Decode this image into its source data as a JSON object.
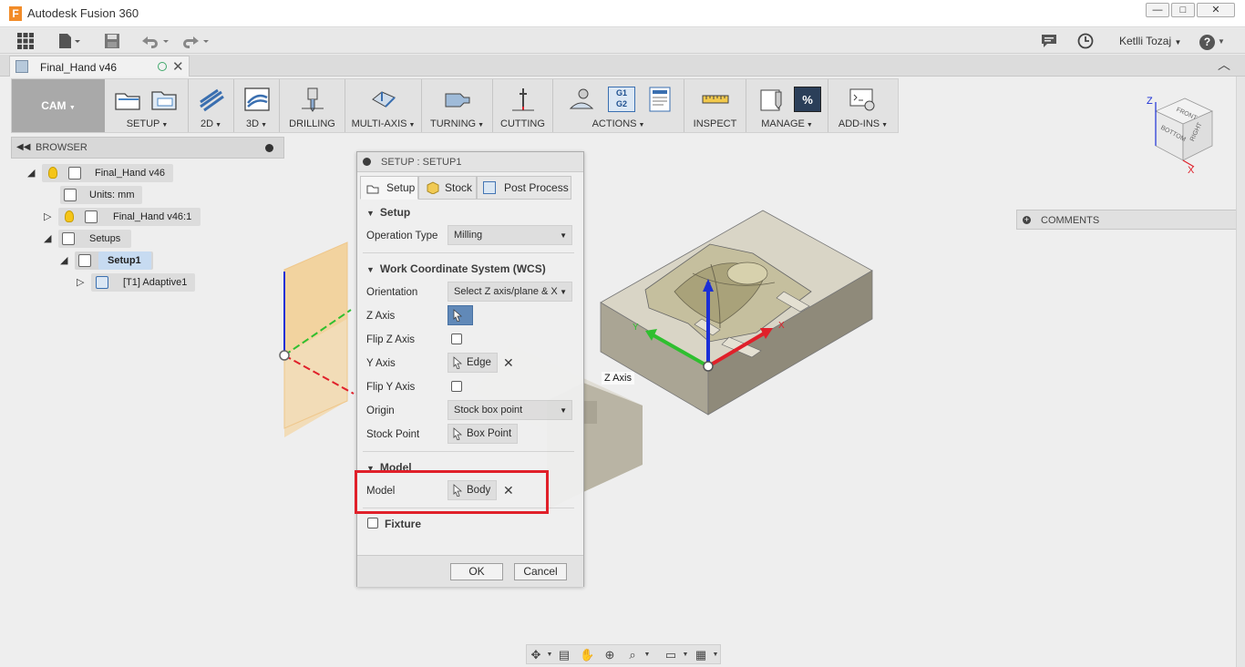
{
  "window": {
    "title": "Autodesk Fusion 360",
    "logo_letter": "F",
    "minimize": "—",
    "maximize": "□",
    "close": "✕"
  },
  "quick_access": {
    "user_name": "Ketlli Tozaj",
    "help": "?"
  },
  "document_tab": {
    "name": "Final_Hand v46",
    "close": "✕"
  },
  "toolbar": {
    "workspace": "CAM",
    "groups": [
      {
        "label": "SETUP"
      },
      {
        "label": "2D"
      },
      {
        "label": "3D"
      },
      {
        "label": "DRILLING"
      },
      {
        "label": "MULTI-AXIS"
      },
      {
        "label": "TURNING"
      },
      {
        "label": "CUTTING"
      },
      {
        "label": "ACTIONS"
      },
      {
        "label": "INSPECT"
      },
      {
        "label": "MANAGE"
      },
      {
        "label": "ADD-INS"
      }
    ],
    "actions_g1": "G1",
    "actions_g2": "G2",
    "manage_percent": "%"
  },
  "browser": {
    "title": "BROWSER",
    "items": [
      {
        "label": "Final_Hand v46"
      },
      {
        "label": "Units: mm"
      },
      {
        "label": "Final_Hand v46:1"
      },
      {
        "label": "Setups"
      },
      {
        "label": "Setup1"
      },
      {
        "label": "[T1] Adaptive1"
      }
    ]
  },
  "dialog": {
    "title": "SETUP : SETUP1",
    "tabs": [
      {
        "label": "Setup"
      },
      {
        "label": "Stock"
      },
      {
        "label": "Post Process"
      }
    ],
    "section_setup": "Setup",
    "operation_type_label": "Operation Type",
    "operation_type_value": "Milling",
    "section_wcs": "Work Coordinate System (WCS)",
    "orientation_label": "Orientation",
    "orientation_value": "Select Z axis/plane & X",
    "z_axis_label": "Z Axis",
    "flip_z_label": "Flip Z Axis",
    "y_axis_label": "Y Axis",
    "y_axis_value": "Edge",
    "flip_y_label": "Flip Y Axis",
    "origin_label": "Origin",
    "origin_value": "Stock box point",
    "stock_point_label": "Stock Point",
    "stock_point_value": "Box Point",
    "section_model": "Model",
    "model_label": "Model",
    "model_value": "Body",
    "fixture_label": "Fixture",
    "ok": "OK",
    "cancel": "Cancel"
  },
  "canvas": {
    "z_axis_tooltip": "Z Axis",
    "triad_z": "Z",
    "triad_y": "Y",
    "triad_x": "X"
  },
  "viewcube": {
    "z": "Z",
    "x": "X",
    "front": "FRONT",
    "bottom": "BOTTOM",
    "right": "RIGHT"
  },
  "comments": {
    "label": "COMMENTS"
  },
  "colors": {
    "highlight": "#e0202a",
    "stock": "#b8b3a3",
    "x_axis": "#e0202a",
    "y_axis": "#2fbf2f",
    "z_axis": "#1b2fd6"
  }
}
